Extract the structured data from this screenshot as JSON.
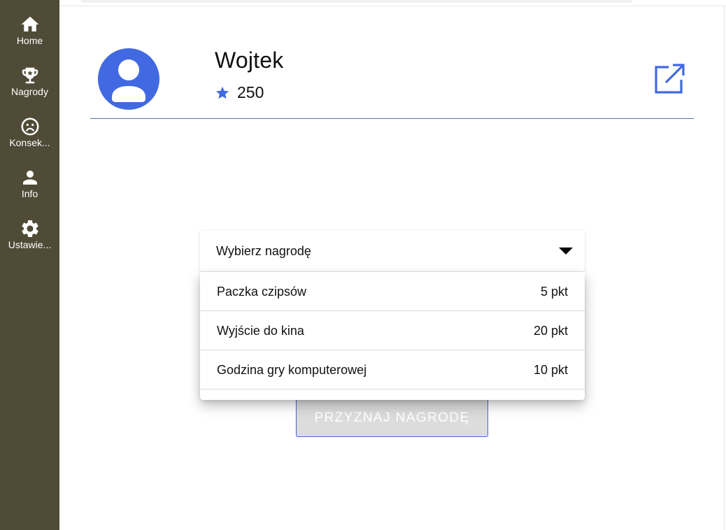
{
  "sidebar": {
    "items": [
      {
        "label": "Home",
        "icon": "home-icon"
      },
      {
        "label": "Nagrody",
        "icon": "trophy-icon"
      },
      {
        "label": "Konsek...",
        "icon": "sad-face-icon"
      },
      {
        "label": "Info",
        "icon": "person-icon"
      },
      {
        "label": "Ustawie...",
        "icon": "gear-icon"
      }
    ]
  },
  "profile": {
    "name": "Wojtek",
    "points": "250",
    "avatar_icon": "user-icon",
    "points_icon": "star-icon",
    "external_icon": "open-in-new-icon"
  },
  "reward_select": {
    "label": "Wybierz nagrodę",
    "options": [
      {
        "name": "Paczka czipsów",
        "cost": "5 pkt"
      },
      {
        "name": "Wyjście do kina",
        "cost": "20 pkt"
      },
      {
        "name": "Godzina gry komputerowej",
        "cost": "10 pkt"
      }
    ]
  },
  "award_button": {
    "label": "PRZYZNAJ NAGRODĘ"
  },
  "colors": {
    "sidebar_bg": "#4f4b37",
    "accent": "#4169e1",
    "button_disabled_bg": "#dcdcdc"
  }
}
